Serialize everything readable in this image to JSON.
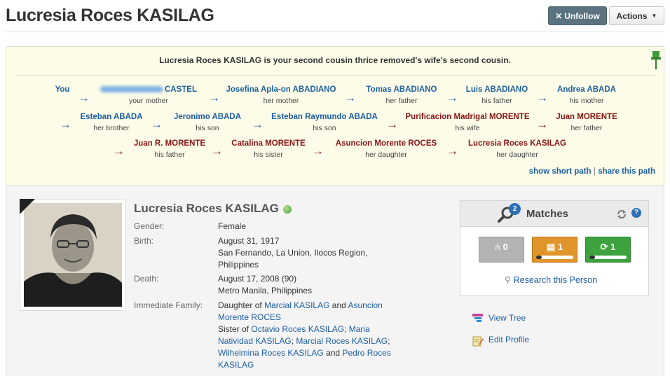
{
  "header": {
    "title": "Lucresia Roces KASILAG",
    "unfollow_label": "Unfollow",
    "actions_label": "Actions"
  },
  "relationship": {
    "summary": "Lucresia Roces KASILAG is your second cousin thrice removed's wife's second cousin.",
    "rows": [
      [
        {
          "name": "You",
          "role": "",
          "color": "#1d5fa3"
        },
        {
          "name": "CASTEL",
          "role": "your mother",
          "color": "#1d5fa3"
        },
        {
          "name": "Josefina Apla-on ABADIANO",
          "role": "her mother",
          "color": "#1d5fa3"
        },
        {
          "name": "Tomas ABADIANO",
          "role": "her father",
          "color": "#1d5fa3"
        },
        {
          "name": "Luis ABADIANO",
          "role": "his father",
          "color": "#1d5fa3"
        },
        {
          "name": "Andrea ABADA",
          "role": "his mother",
          "color": "#1d5fa3"
        }
      ],
      [
        {
          "name": "Esteban ABADA",
          "role": "her brother",
          "color": "#1d5fa3"
        },
        {
          "name": "Jeronimo ABADA",
          "role": "his son",
          "color": "#1d5fa3"
        },
        {
          "name": "Esteban Raymundo ABADA",
          "role": "his son",
          "color": "#1d5fa3"
        },
        {
          "name": "Purificacion Madrigal MORENTE",
          "role": "his wife",
          "color": "#8a1414"
        },
        {
          "name": "Juan MORENTE",
          "role": "her father",
          "color": "#8a1414"
        }
      ],
      [
        {
          "name": "Juan R. MORENTE",
          "role": "his father",
          "color": "#8a1414"
        },
        {
          "name": "Catalina MORENTE",
          "role": "his sister",
          "color": "#8a1414"
        },
        {
          "name": "Asuncion Morente ROCES",
          "role": "her daughter",
          "color": "#8a1414"
        },
        {
          "name": "Lucresia Roces KASILAG",
          "role": "her daughter",
          "color": "#8a1414"
        }
      ]
    ],
    "show_short_path": "show short path",
    "separator": "|",
    "share_path": "share this path"
  },
  "profile": {
    "name": "Lucresia Roces KASILAG",
    "gender_label": "Gender:",
    "gender": "Female",
    "birth_label": "Birth:",
    "birth_date": "August 31, 1917",
    "birth_place": "San Fernando, La Union, Ilocos Region, Philippines",
    "death_label": "Death:",
    "death_date": "August 17, 2008 (90)",
    "death_place": "Metro Manila, Philippines",
    "family_label": "Immediate Family:",
    "family": {
      "daughter_of": "Daughter of",
      "father": "Marcial KASILAG",
      "and1": "and",
      "mother": "Asuncion Morente ROCES",
      "sister_of": "Sister of",
      "sib1": "Octavio Roces KASILAG",
      "sib2": "Maria Natividad KASILAG",
      "sib3": "Marcial Roces KASILAG",
      "sib4": "Wilhelmina Roces KASILAG",
      "and2": "and",
      "sib5": "Pedro Roces KASILAG"
    }
  },
  "matches": {
    "title": "Matches",
    "badge_count": "2",
    "tree_count": "0",
    "record_count": "1",
    "smart_count": "1",
    "research_label": "Research this Person"
  },
  "sidebar_links": {
    "view_tree": "View Tree",
    "edit_profile": "Edit Profile"
  },
  "colors": {
    "link_blue": "#1d5fa3",
    "spouse_red": "#8a1414",
    "panel_bg": "#fcfce8",
    "unfollow_bg": "#5b7380",
    "tree_match_bg": "#b3b3b3",
    "record_match_bg": "#e0952b",
    "smart_match_bg": "#3ea33e"
  }
}
